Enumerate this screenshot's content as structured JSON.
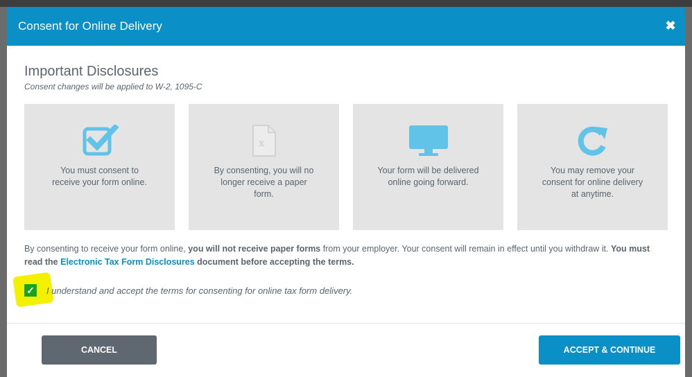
{
  "dialog": {
    "title": "Consent for Online Delivery",
    "close_icon": "close-icon"
  },
  "content": {
    "heading": "Important Disclosures",
    "subheading": "Consent changes will be applied to W-2, 1095-C",
    "cards": [
      {
        "icon": "checkbox-icon",
        "text": "You must consent to receive your form online."
      },
      {
        "icon": "document-x-icon",
        "text": "By consenting, you will no longer receive a paper form."
      },
      {
        "icon": "monitor-icon",
        "text": "Your form will be delivered online going forward."
      },
      {
        "icon": "refresh-icon",
        "text": "You may remove your consent for online delivery at anytime."
      }
    ],
    "notice": {
      "part1": "By consenting to receive your form online, ",
      "bold1": "you will not receive paper forms",
      "part2": " from your employer. Your consent will remain in effect until you withdraw it. ",
      "bold2": "You must read the ",
      "link": "Electronic Tax Form Disclosures",
      "part3": " document before accepting the terms."
    },
    "consent": {
      "checked": true,
      "label": "I understand and accept the terms for consenting for online tax form delivery."
    }
  },
  "footer": {
    "cancel_label": "CANCEL",
    "accept_label": "ACCEPT & CONTINUE"
  },
  "colors": {
    "accent": "#0a8fc7",
    "icon": "#62c3e8",
    "checkbox": "#16a51c",
    "highlight": "#f3f000"
  }
}
